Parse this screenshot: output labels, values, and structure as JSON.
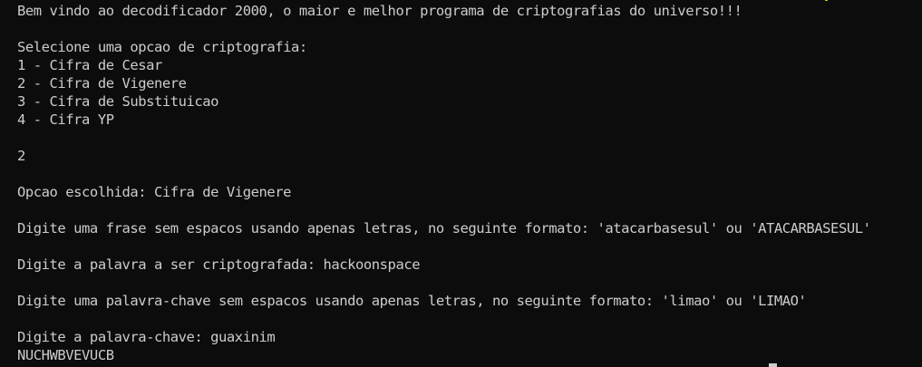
{
  "terminal": {
    "lines": [
      "Bem vindo ao decodificador 2000, o maior e melhor programa de criptografias do universo!!!",
      "",
      "Selecione uma opcao de criptografia:",
      "1 - Cifra de Cesar",
      "2 - Cifra de Vigenere",
      "3 - Cifra de Substituicao",
      "4 - Cifra YP",
      "",
      "2",
      "",
      "Opcao escolhida: Cifra de Vigenere",
      "",
      "Digite uma frase sem espacos usando apenas letras, no seguinte formato: 'atacarbasesul' ou 'ATACARBASESUL'",
      "",
      "Digite a palavra a ser criptografada: hackoonspace",
      "",
      "Digite uma palavra-chave sem espacos usando apenas letras, no seguinte formato: 'limao' ou 'LIMAO'",
      "",
      "Digite a palavra-chave: guaxinim",
      "NUCHWBVEVUCB"
    ]
  },
  "colors": {
    "background": "#0c0c0c",
    "foreground": "#cccccc"
  }
}
